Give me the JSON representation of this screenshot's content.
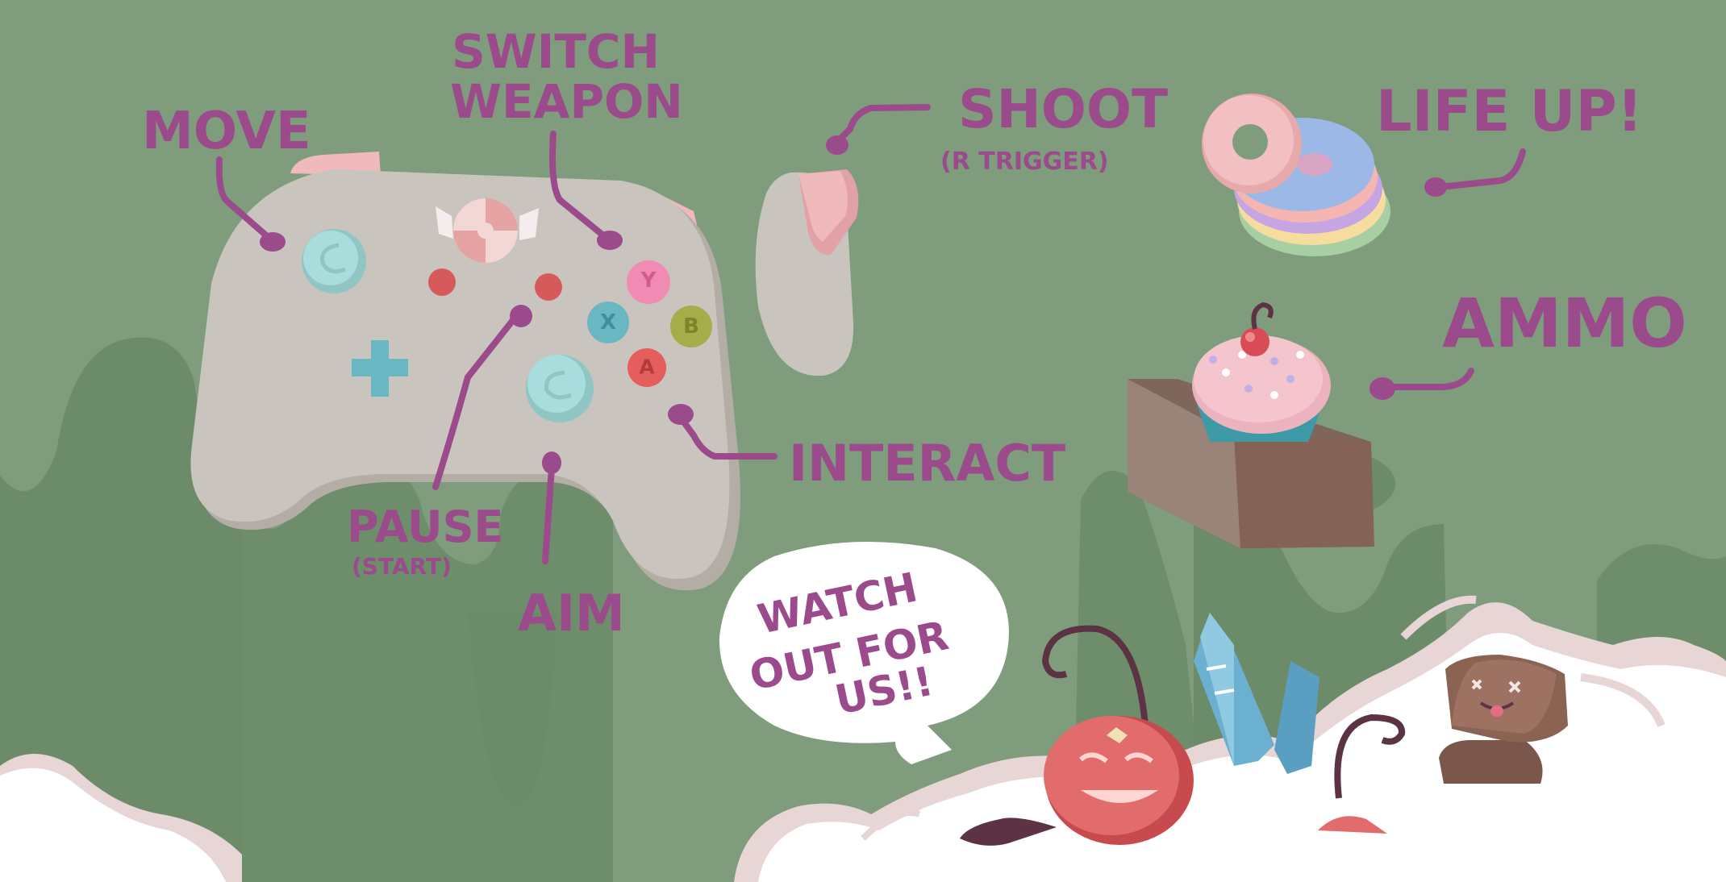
{
  "labels": {
    "move": "MOVE",
    "switch_weapon_line1": "SWITCH",
    "switch_weapon_line2": "WEAPON",
    "shoot": "SHOOT",
    "shoot_sub": "(R TRIGGER)",
    "life_up": "LIFE UP!",
    "ammo": "AMMO",
    "interact": "INTERACT",
    "pause": "PAUSE",
    "pause_sub": "(START)",
    "aim": "AIM"
  },
  "speech_bubble": {
    "line1": "WATCH",
    "line2": "OUT FOR",
    "line3": "US!!"
  },
  "face_buttons": {
    "y": "Y",
    "x": "X",
    "b": "B",
    "a": "A"
  },
  "colors": {
    "background": "#7f9c7c",
    "drip": "#6b8b69",
    "label": "#9b4a8c",
    "controller": "#c9c4be",
    "cloud": "#ffffff",
    "cloud_shade": "#e8d6d6"
  },
  "icons": [
    "controller-icon",
    "candy-icon",
    "donut-stack-icon",
    "cupcake-icon",
    "cherry-enemy-icon",
    "crystal-enemy-icon",
    "chocolate-enemy-icon",
    "pointing-hand-icon"
  ]
}
